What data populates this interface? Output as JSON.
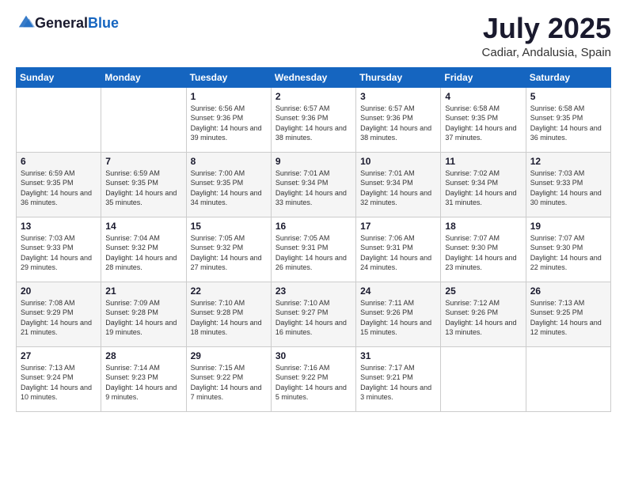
{
  "logo": {
    "general": "General",
    "blue": "Blue"
  },
  "header": {
    "month": "July 2025",
    "location": "Cadiar, Andalusia, Spain"
  },
  "weekdays": [
    "Sunday",
    "Monday",
    "Tuesday",
    "Wednesday",
    "Thursday",
    "Friday",
    "Saturday"
  ],
  "weeks": [
    [
      {
        "day": "",
        "sunrise": "",
        "sunset": "",
        "daylight": ""
      },
      {
        "day": "",
        "sunrise": "",
        "sunset": "",
        "daylight": ""
      },
      {
        "day": "1",
        "sunrise": "Sunrise: 6:56 AM",
        "sunset": "Sunset: 9:36 PM",
        "daylight": "Daylight: 14 hours and 39 minutes."
      },
      {
        "day": "2",
        "sunrise": "Sunrise: 6:57 AM",
        "sunset": "Sunset: 9:36 PM",
        "daylight": "Daylight: 14 hours and 38 minutes."
      },
      {
        "day": "3",
        "sunrise": "Sunrise: 6:57 AM",
        "sunset": "Sunset: 9:36 PM",
        "daylight": "Daylight: 14 hours and 38 minutes."
      },
      {
        "day": "4",
        "sunrise": "Sunrise: 6:58 AM",
        "sunset": "Sunset: 9:35 PM",
        "daylight": "Daylight: 14 hours and 37 minutes."
      },
      {
        "day": "5",
        "sunrise": "Sunrise: 6:58 AM",
        "sunset": "Sunset: 9:35 PM",
        "daylight": "Daylight: 14 hours and 36 minutes."
      }
    ],
    [
      {
        "day": "6",
        "sunrise": "Sunrise: 6:59 AM",
        "sunset": "Sunset: 9:35 PM",
        "daylight": "Daylight: 14 hours and 36 minutes."
      },
      {
        "day": "7",
        "sunrise": "Sunrise: 6:59 AM",
        "sunset": "Sunset: 9:35 PM",
        "daylight": "Daylight: 14 hours and 35 minutes."
      },
      {
        "day": "8",
        "sunrise": "Sunrise: 7:00 AM",
        "sunset": "Sunset: 9:35 PM",
        "daylight": "Daylight: 14 hours and 34 minutes."
      },
      {
        "day": "9",
        "sunrise": "Sunrise: 7:01 AM",
        "sunset": "Sunset: 9:34 PM",
        "daylight": "Daylight: 14 hours and 33 minutes."
      },
      {
        "day": "10",
        "sunrise": "Sunrise: 7:01 AM",
        "sunset": "Sunset: 9:34 PM",
        "daylight": "Daylight: 14 hours and 32 minutes."
      },
      {
        "day": "11",
        "sunrise": "Sunrise: 7:02 AM",
        "sunset": "Sunset: 9:34 PM",
        "daylight": "Daylight: 14 hours and 31 minutes."
      },
      {
        "day": "12",
        "sunrise": "Sunrise: 7:03 AM",
        "sunset": "Sunset: 9:33 PM",
        "daylight": "Daylight: 14 hours and 30 minutes."
      }
    ],
    [
      {
        "day": "13",
        "sunrise": "Sunrise: 7:03 AM",
        "sunset": "Sunset: 9:33 PM",
        "daylight": "Daylight: 14 hours and 29 minutes."
      },
      {
        "day": "14",
        "sunrise": "Sunrise: 7:04 AM",
        "sunset": "Sunset: 9:32 PM",
        "daylight": "Daylight: 14 hours and 28 minutes."
      },
      {
        "day": "15",
        "sunrise": "Sunrise: 7:05 AM",
        "sunset": "Sunset: 9:32 PM",
        "daylight": "Daylight: 14 hours and 27 minutes."
      },
      {
        "day": "16",
        "sunrise": "Sunrise: 7:05 AM",
        "sunset": "Sunset: 9:31 PM",
        "daylight": "Daylight: 14 hours and 26 minutes."
      },
      {
        "day": "17",
        "sunrise": "Sunrise: 7:06 AM",
        "sunset": "Sunset: 9:31 PM",
        "daylight": "Daylight: 14 hours and 24 minutes."
      },
      {
        "day": "18",
        "sunrise": "Sunrise: 7:07 AM",
        "sunset": "Sunset: 9:30 PM",
        "daylight": "Daylight: 14 hours and 23 minutes."
      },
      {
        "day": "19",
        "sunrise": "Sunrise: 7:07 AM",
        "sunset": "Sunset: 9:30 PM",
        "daylight": "Daylight: 14 hours and 22 minutes."
      }
    ],
    [
      {
        "day": "20",
        "sunrise": "Sunrise: 7:08 AM",
        "sunset": "Sunset: 9:29 PM",
        "daylight": "Daylight: 14 hours and 21 minutes."
      },
      {
        "day": "21",
        "sunrise": "Sunrise: 7:09 AM",
        "sunset": "Sunset: 9:28 PM",
        "daylight": "Daylight: 14 hours and 19 minutes."
      },
      {
        "day": "22",
        "sunrise": "Sunrise: 7:10 AM",
        "sunset": "Sunset: 9:28 PM",
        "daylight": "Daylight: 14 hours and 18 minutes."
      },
      {
        "day": "23",
        "sunrise": "Sunrise: 7:10 AM",
        "sunset": "Sunset: 9:27 PM",
        "daylight": "Daylight: 14 hours and 16 minutes."
      },
      {
        "day": "24",
        "sunrise": "Sunrise: 7:11 AM",
        "sunset": "Sunset: 9:26 PM",
        "daylight": "Daylight: 14 hours and 15 minutes."
      },
      {
        "day": "25",
        "sunrise": "Sunrise: 7:12 AM",
        "sunset": "Sunset: 9:26 PM",
        "daylight": "Daylight: 14 hours and 13 minutes."
      },
      {
        "day": "26",
        "sunrise": "Sunrise: 7:13 AM",
        "sunset": "Sunset: 9:25 PM",
        "daylight": "Daylight: 14 hours and 12 minutes."
      }
    ],
    [
      {
        "day": "27",
        "sunrise": "Sunrise: 7:13 AM",
        "sunset": "Sunset: 9:24 PM",
        "daylight": "Daylight: 14 hours and 10 minutes."
      },
      {
        "day": "28",
        "sunrise": "Sunrise: 7:14 AM",
        "sunset": "Sunset: 9:23 PM",
        "daylight": "Daylight: 14 hours and 9 minutes."
      },
      {
        "day": "29",
        "sunrise": "Sunrise: 7:15 AM",
        "sunset": "Sunset: 9:22 PM",
        "daylight": "Daylight: 14 hours and 7 minutes."
      },
      {
        "day": "30",
        "sunrise": "Sunrise: 7:16 AM",
        "sunset": "Sunset: 9:22 PM",
        "daylight": "Daylight: 14 hours and 5 minutes."
      },
      {
        "day": "31",
        "sunrise": "Sunrise: 7:17 AM",
        "sunset": "Sunset: 9:21 PM",
        "daylight": "Daylight: 14 hours and 3 minutes."
      },
      {
        "day": "",
        "sunrise": "",
        "sunset": "",
        "daylight": ""
      },
      {
        "day": "",
        "sunrise": "",
        "sunset": "",
        "daylight": ""
      }
    ]
  ]
}
